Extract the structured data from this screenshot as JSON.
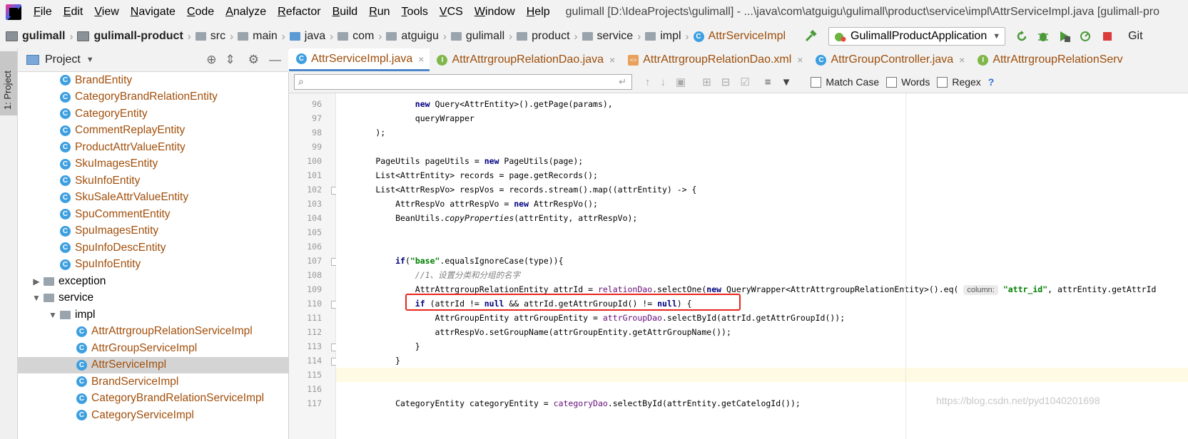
{
  "menubar": {
    "items": [
      "File",
      "Edit",
      "View",
      "Navigate",
      "Code",
      "Analyze",
      "Refactor",
      "Build",
      "Run",
      "Tools",
      "VCS",
      "Window",
      "Help"
    ],
    "window_title": "gulimall [D:\\IdeaProjects\\gulimall] - ...\\java\\com\\atguigu\\gulimall\\product\\service\\impl\\AttrServiceImpl.java [gulimall-pro"
  },
  "navbar": {
    "crumbs": [
      "gulimall",
      "gulimall-product",
      "src",
      "main",
      "java",
      "com",
      "atguigu",
      "gulimall",
      "product",
      "service",
      "impl",
      "AttrServiceImpl"
    ],
    "run_config": "GulimallProductApplication",
    "git_label": "Git"
  },
  "leftstrip": {
    "project_tab": "1: Project"
  },
  "project_panel": {
    "title": "Project",
    "tree": [
      {
        "label": "BrandEntity",
        "type": "class",
        "indent": 1
      },
      {
        "label": "CategoryBrandRelationEntity",
        "type": "class",
        "indent": 1
      },
      {
        "label": "CategoryEntity",
        "type": "class",
        "indent": 1
      },
      {
        "label": "CommentReplayEntity",
        "type": "class",
        "indent": 1
      },
      {
        "label": "ProductAttrValueEntity",
        "type": "class",
        "indent": 1
      },
      {
        "label": "SkuImagesEntity",
        "type": "class",
        "indent": 1
      },
      {
        "label": "SkuInfoEntity",
        "type": "class",
        "indent": 1
      },
      {
        "label": "SkuSaleAttrValueEntity",
        "type": "class",
        "indent": 1
      },
      {
        "label": "SpuCommentEntity",
        "type": "class",
        "indent": 1
      },
      {
        "label": "SpuImagesEntity",
        "type": "class",
        "indent": 1
      },
      {
        "label": "SpuInfoDescEntity",
        "type": "class",
        "indent": 1
      },
      {
        "label": "SpuInfoEntity",
        "type": "class",
        "indent": 1
      },
      {
        "label": "exception",
        "type": "dir",
        "indent": 0,
        "arrow": "▶"
      },
      {
        "label": "service",
        "type": "dir",
        "indent": 0,
        "arrow": "▼"
      },
      {
        "label": "impl",
        "type": "dir",
        "indent": 1,
        "arrow": "▼"
      },
      {
        "label": "AttrAttrgroupRelationServiceImpl",
        "type": "class",
        "indent": 2
      },
      {
        "label": "AttrGroupServiceImpl",
        "type": "class",
        "indent": 2
      },
      {
        "label": "AttrServiceImpl",
        "type": "class",
        "indent": 2,
        "selected": true
      },
      {
        "label": "BrandServiceImpl",
        "type": "class",
        "indent": 2
      },
      {
        "label": "CategoryBrandRelationServiceImpl",
        "type": "class",
        "indent": 2
      },
      {
        "label": "CategoryServiceImpl",
        "type": "class",
        "indent": 2
      }
    ]
  },
  "editor_tabs": [
    {
      "label": "AttrServiceImpl.java",
      "icon": "class",
      "active": true
    },
    {
      "label": "AttrAttrgroupRelationDao.java",
      "icon": "interface"
    },
    {
      "label": "AttrAttrgroupRelationDao.xml",
      "icon": "xml"
    },
    {
      "label": "AttrGroupController.java",
      "icon": "class"
    },
    {
      "label": "AttrAttrgroupRelationServ",
      "icon": "interface"
    }
  ],
  "searchbar": {
    "placeholder": "",
    "match_case": "Match Case",
    "words": "Words",
    "regex": "Regex",
    "help": "?"
  },
  "editor": {
    "current_line": 115,
    "lines": [
      {
        "n": "96",
        "html": "                <span class=\"kw\">new</span> Query&lt;AttrEntity&gt;().getPage(params),"
      },
      {
        "n": "97",
        "html": "                queryWrapper"
      },
      {
        "n": "98",
        "html": "        );"
      },
      {
        "n": "99",
        "html": ""
      },
      {
        "n": "100",
        "html": "        PageUtils pageUtils = <span class=\"kw\">new</span> PageUtils(page);"
      },
      {
        "n": "101",
        "html": "        List&lt;AttrEntity&gt; records = page.getRecords();"
      },
      {
        "n": "102",
        "html": "        List&lt;AttrRespVo&gt; respVos = records.stream().map((attrEntity) -&gt; {"
      },
      {
        "n": "103",
        "html": "            AttrRespVo attrRespVo = <span class=\"kw\">new</span> AttrRespVo();"
      },
      {
        "n": "104",
        "html": "            BeanUtils.<span class=\"ital\">copyProperties</span>(attrEntity, attrRespVo);"
      },
      {
        "n": "105",
        "html": ""
      },
      {
        "n": "106",
        "html": ""
      },
      {
        "n": "107",
        "html": "            <span class=\"kw\">if</span>(<span class=\"str\">\"base\"</span>.equalsIgnoreCase(type)){"
      },
      {
        "n": "108",
        "html": "                <span class=\"cmt\">//1、设置分类和分组的名字</span>"
      },
      {
        "n": "109",
        "html": "                AttrAttrgroupRelationEntity attrId = <span class=\"fld\">relationDao</span>.selectOne(<span class=\"kw\">new</span> QueryWrapper&lt;AttrAttrgroupRelationEntity&gt;().eq( <span class=\"hint\">column:</span> <span class=\"str\">\"attr_id\"</span>, attrEntity.getAttrId"
      },
      {
        "n": "110",
        "html": "                <span class=\"kw\">if</span> (attrId != <span class=\"kw\">null</span> &amp;&amp; attrId.getAttrGroupId() != <span class=\"kw\">null</span>) {"
      },
      {
        "n": "111",
        "html": "                    AttrGroupEntity attrGroupEntity = <span class=\"fld\">attrGroupDao</span>.selectById(attrId.getAttrGroupId());"
      },
      {
        "n": "112",
        "html": "                    attrRespVo.setGroupName(attrGroupEntity.getAttrGroupName());"
      },
      {
        "n": "113",
        "html": "                }"
      },
      {
        "n": "114",
        "html": "            }"
      },
      {
        "n": "115",
        "html": ""
      },
      {
        "n": "116",
        "html": ""
      },
      {
        "n": "117",
        "html": "            CategoryEntity categoryEntity = <span class=\"fld\">categoryDao</span>.selectById(attrEntity.getCatelogId());"
      }
    ]
  },
  "watermark": "https://blog.csdn.net/pyd1040201698"
}
